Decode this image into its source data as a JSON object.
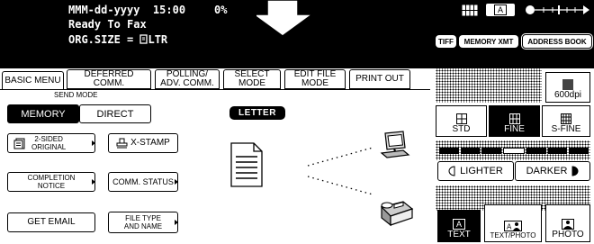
{
  "status": {
    "datetime": "MMM-dd-yyyy  15:00",
    "percent": "0%",
    "message": "Ready To Fax",
    "orgsize": "ORG.SIZE = ",
    "orgsize_value": "LTR"
  },
  "top_buttons": {
    "tiff": "TIFF",
    "memory_xmt": "MEMORY XMT",
    "address_book": "ADDRESS BOOK",
    "icon_letter": "A"
  },
  "tabs": {
    "basic_menu": "BASIC MENU",
    "deferred_1": "DEFERRED",
    "deferred_2": "COMM.",
    "polling_1": "POLLING/",
    "polling_2": "ADV. COMM.",
    "select_1": "SELECT",
    "select_2": "MODE",
    "editfile_1": "EDIT FILE",
    "editfile_2": "MODE",
    "print_out": "PRINT OUT"
  },
  "send_mode": {
    "title": "SEND MODE",
    "memory": "MEMORY",
    "direct": "DIRECT"
  },
  "options": {
    "two_sided_1": "2-SIDED",
    "two_sided_2": "ORIGINAL",
    "x_stamp": "X-STAMP",
    "completion_1": "COMPLETION",
    "completion_2": "NOTICE",
    "comm_status": "COMM. STATUS",
    "get_email": "GET EMAIL",
    "filetype_1": "FILE TYPE",
    "filetype_2": "AND NAME"
  },
  "letter_badge": "LETTER",
  "resolution": {
    "dpi": "600dpi",
    "std": "STD",
    "fine": "FINE",
    "sfine": "S-FINE"
  },
  "density": {
    "lighter": "LIGHTER",
    "darker": "DARKER"
  },
  "mode": {
    "text": "TEXT",
    "text_photo": "TEXT/PHOTO",
    "photo": "PHOTO",
    "letter_a": "A"
  }
}
